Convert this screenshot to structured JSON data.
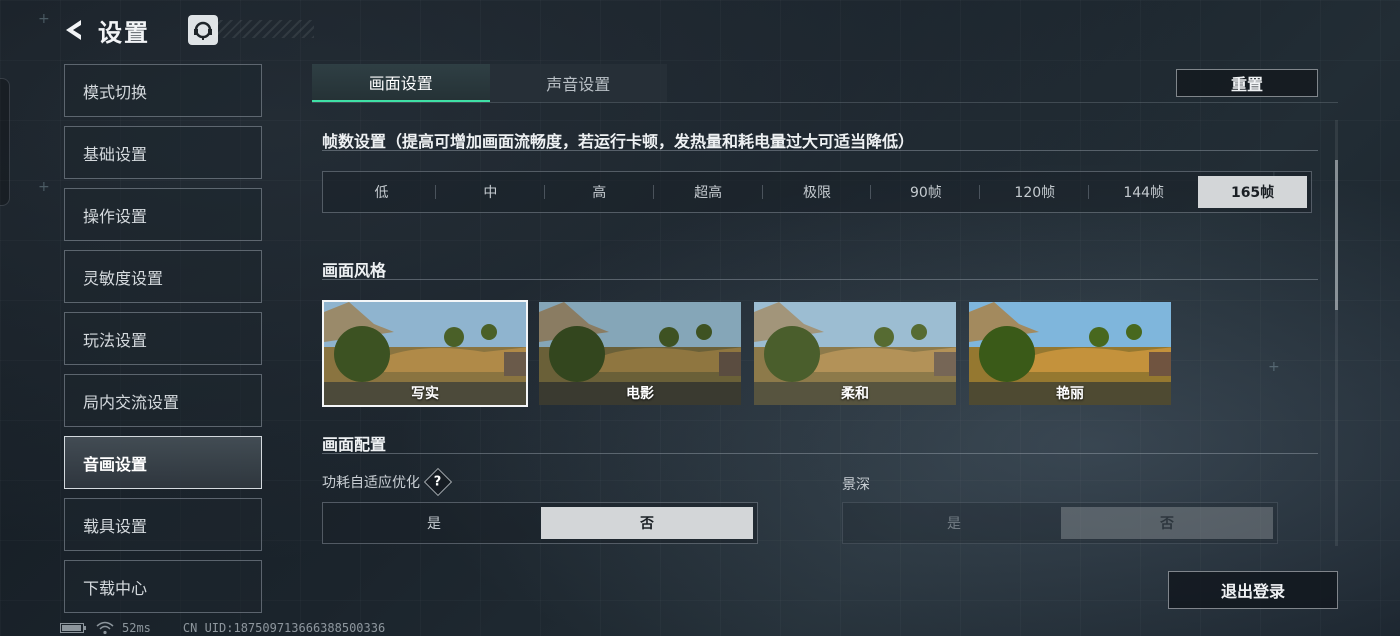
{
  "header": {
    "title": "设置",
    "back_icon": "chevron-left-icon",
    "service_icon": "headset-icon"
  },
  "sidebar": {
    "items": [
      {
        "label": "模式切换"
      },
      {
        "label": "基础设置"
      },
      {
        "label": "操作设置"
      },
      {
        "label": "灵敏度设置"
      },
      {
        "label": "玩法设置"
      },
      {
        "label": "局内交流设置"
      },
      {
        "label": "音画设置",
        "active": true
      },
      {
        "label": "载具设置"
      },
      {
        "label": "下载中心"
      }
    ]
  },
  "tabs": [
    {
      "label": "画面设置",
      "active": true
    },
    {
      "label": "声音设置"
    }
  ],
  "reset_label": "重置",
  "fps": {
    "title": "帧数设置（提高可增加画面流畅度，若运行卡顿，发热量和耗电量过大可适当降低）",
    "options": [
      "低",
      "中",
      "高",
      "超高",
      "极限",
      "90帧",
      "120帧",
      "144帧",
      "165帧"
    ],
    "selected": "165帧"
  },
  "style": {
    "title": "画面风格",
    "options": [
      {
        "label": "写实",
        "selected": true
      },
      {
        "label": "电影"
      },
      {
        "label": "柔和"
      },
      {
        "label": "艳丽"
      }
    ]
  },
  "config": {
    "title": "画面配置",
    "power_opt": {
      "label": "功耗自适应优化",
      "help": "?",
      "options": [
        "是",
        "否"
      ],
      "selected": "否"
    },
    "depth": {
      "label": "景深",
      "options": [
        "是",
        "否"
      ],
      "selected": "否",
      "disabled": true
    }
  },
  "logout_label": "退出登录",
  "status": {
    "ping": "52ms",
    "uid": "CN UID:1875097136663885003​36"
  },
  "colors": {
    "accent": "#3fe0a6",
    "selected_bg": "#d3d6d8"
  }
}
